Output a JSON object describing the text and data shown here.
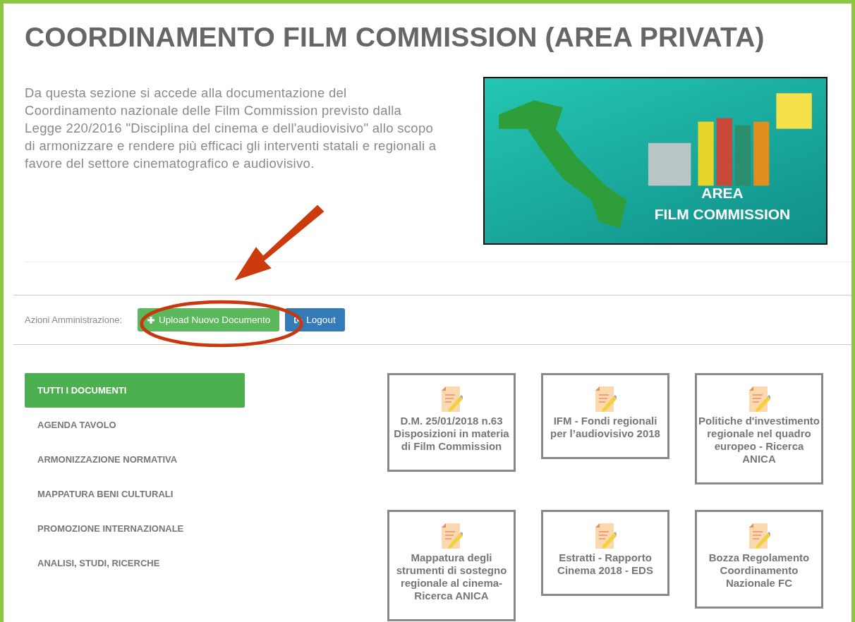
{
  "title": "COORDINAMENTO FILM COMMISSION (AREA PRIVATA)",
  "intro": "Da questa sezione si accede alla documentazione del Coordinamento nazionale delle Film Commission previsto dalla Legge 220/2016 \"Disciplina del cinema e dell'audiovisivo\" allo scopo di armonizzare e rendere più efficaci gli interventi statali e regionali a favore del settore cinematografico e audiovisivo.",
  "banner": {
    "caption_lines": [
      "AREA",
      "FILM COMMISSION"
    ]
  },
  "admin_actions": {
    "label": "Azioni Amministrazione:",
    "buttons": [
      {
        "kind": "upload",
        "label": "Upload Nuovo Documento"
      },
      {
        "kind": "logout",
        "label": "Logout"
      }
    ]
  },
  "categories": [
    {
      "label": "TUTTI I DOCUMENTI",
      "selected": true
    },
    {
      "label": "AGENDA TAVOLO",
      "selected": false
    },
    {
      "label": "ARMONIZZAZIONE NORMATIVA",
      "selected": false
    },
    {
      "label": "MAPPATURA BENI CULTURALI",
      "selected": false
    },
    {
      "label": "PROMOZIONE INTERNAZIONALE",
      "selected": false
    },
    {
      "label": "ANALISI, STUDI, RICERCHE",
      "selected": false
    }
  ],
  "documents": [
    {
      "title": "D.M. 25/01/2018 n.63 Disposizioni in materia di Film Commission"
    },
    {
      "title": "IFM - Fondi regionali per l’audiovisivo 2018"
    },
    {
      "title": "Politiche d'investimento regionale nel quadro europeo - Ricerca ANICA"
    },
    {
      "title": "Mappatura degli strumenti di sostegno regionale al cinema- Ricerca ANICA"
    },
    {
      "title": "Estratti - Rapporto Cinema 2018 - EDS"
    },
    {
      "title": "Bozza Regolamento Coordinamento Nazionale FC"
    }
  ]
}
